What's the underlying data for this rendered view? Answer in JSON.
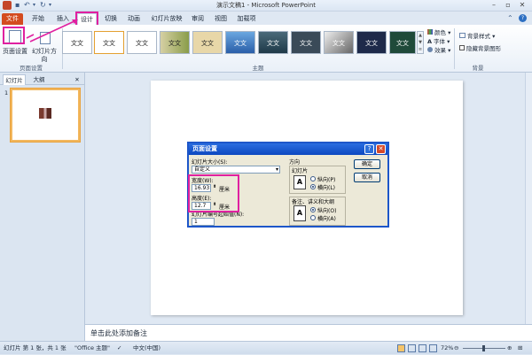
{
  "app": {
    "title": "演示文稿1 - Microsoft PowerPoint"
  },
  "tabs": [
    "文件",
    "开始",
    "插入",
    "设计",
    "切换",
    "动画",
    "幻灯片放映",
    "审阅",
    "视图",
    "加载项"
  ],
  "ribbon": {
    "page_setup_label": "页面设置",
    "orientation_label": "幻灯片方向",
    "theme_sample": "文文",
    "colors_label": "颜色",
    "fonts_label": "字体",
    "effects_label": "效果",
    "bg_styles_label": "背景样式",
    "hide_bg_label": "隐藏背景图形",
    "groups": {
      "page_setup": "页面设置",
      "themes": "主题",
      "background": "背景"
    }
  },
  "left_pane": {
    "tab_slides": "幻灯片",
    "tab_outline": "大纲",
    "slide_number": "1"
  },
  "dialog": {
    "title": "页面设置",
    "size_label": "幻灯片大小(S):",
    "size_value": "自定义",
    "width_label": "宽度(W):",
    "width_value": "16.93",
    "height_label": "高度(E):",
    "height_value": "12.7",
    "unit": "厘米",
    "start_label": "幻灯片编号起始值(N):",
    "start_value": "1",
    "orientation_group": "方向",
    "slides_group": "幻灯片",
    "notes_group": "备注、讲义和大纲",
    "portrait": "纵向(P)",
    "landscape": "横向(L)",
    "portrait2": "纵向(O)",
    "landscape2": "横向(A)",
    "ok": "确定",
    "cancel": "取消"
  },
  "notes": {
    "placeholder": "单击此处添加备注"
  },
  "status": {
    "slide_info": "幻灯片 第 1 张，共 1 张",
    "theme": "\"Office 主题\"",
    "language": "中文(中国)",
    "zoom": "72%"
  }
}
